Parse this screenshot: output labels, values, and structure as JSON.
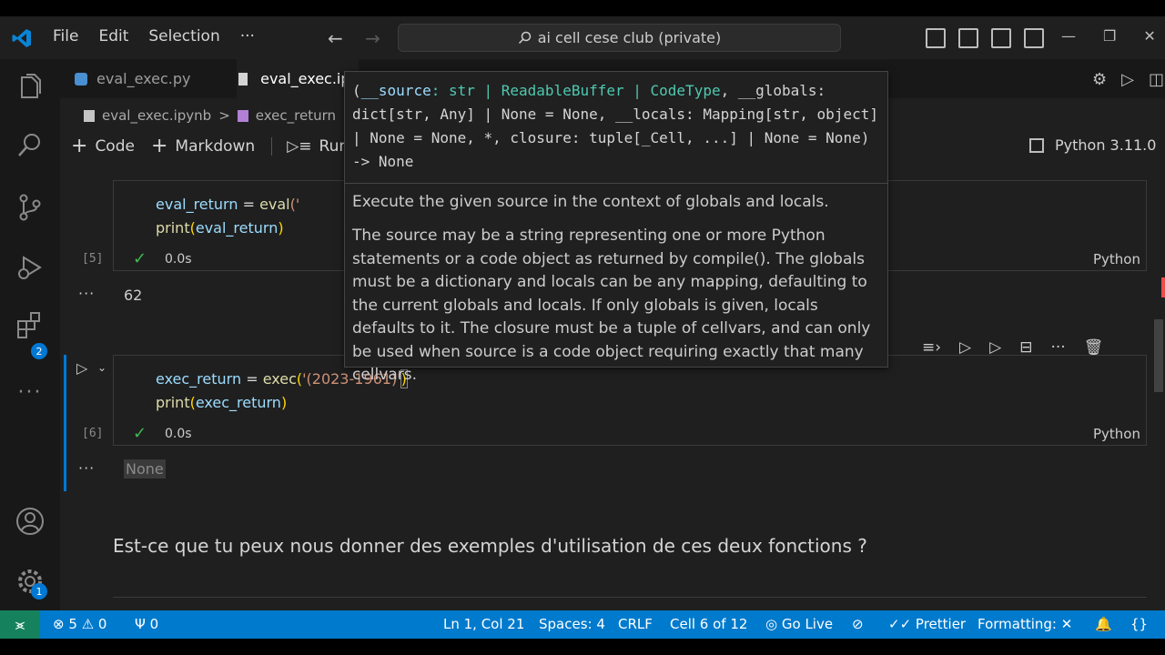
{
  "menu": {
    "file": "File",
    "edit": "Edit",
    "selection": "Selection",
    "more": "···"
  },
  "search": {
    "text": "ai cell cese club (private)"
  },
  "tabs": [
    {
      "label": "eval_exec.py",
      "active": false
    },
    {
      "label": "eval_exec.ipy",
      "active": true
    }
  ],
  "breadcrumb": {
    "file": "eval_exec.ipynb",
    "sep": ">",
    "cell": "exec_return"
  },
  "nb_toolbar": {
    "code": "Code",
    "markdown": "Markdown",
    "run": "Run A"
  },
  "kernel": {
    "label": "Python 3.11.0"
  },
  "cells": [
    {
      "line1": {
        "var": "eval_return",
        "eq": " = ",
        "fn": "eval",
        "rest": "('"
      },
      "line2": {
        "fn": "print",
        "open": "(",
        "arg": "eval_return",
        "close": ")"
      },
      "exec_count": "[5]",
      "timing": "0.0s",
      "language": "Python",
      "output_more": "···",
      "output": "62"
    },
    {
      "line1": {
        "var": "exec_return",
        "eq": " = ",
        "fn": "exec",
        "open": "(",
        "str": "'(2023-1961)'",
        "close": ")"
      },
      "line2": {
        "fn": "print",
        "open": "(",
        "arg": "exec_return",
        "close": ")"
      },
      "exec_count": "[6]",
      "timing": "0.0s",
      "language": "Python",
      "output_more": "···",
      "output": "None"
    }
  ],
  "markdown_text": "Est-ce que tu peux nous donner des exemples d'utilisation de ces deux fonctions ?",
  "hover": {
    "sig_open": "(",
    "sig_param1": "__source",
    "sig_type1": ": str | ReadableBuffer | CodeType",
    "sig_rest": ", __globals: dict[str, Any] | None = None, __locals: Mapping[str, object] | None = None, *, closure: tuple[_Cell, ...] | None = None) -> None",
    "summary": "Execute the given source in the context of globals and locals.",
    "detail": "The source may be a string representing one or more Python statements or a code object as returned by compile(). The globals must be a dictionary and locals can be any mapping, defaulting to the current globals and locals. If only globals is given, locals defaults to it. The closure must be a tuple of cellvars, and can only be used when source is a code object requiring exactly that many cellvars."
  },
  "activity_badges": {
    "extensions": "2",
    "settings": "1"
  },
  "status": {
    "remote": "⪤",
    "errors": "5",
    "warnings": "0",
    "ports": "0",
    "position": "Ln 1, Col 21",
    "spaces": "Spaces: 4",
    "eol": "CRLF",
    "cell": "Cell 6 of 12",
    "golive": "Go Live",
    "prettier": "Prettier",
    "formatting": "Formatting: ✕"
  },
  "colors": {
    "accent": "#007acc",
    "remote": "#16825d",
    "background": "#1f1f1f",
    "error": "#f14c4c",
    "success": "#3fb950"
  }
}
